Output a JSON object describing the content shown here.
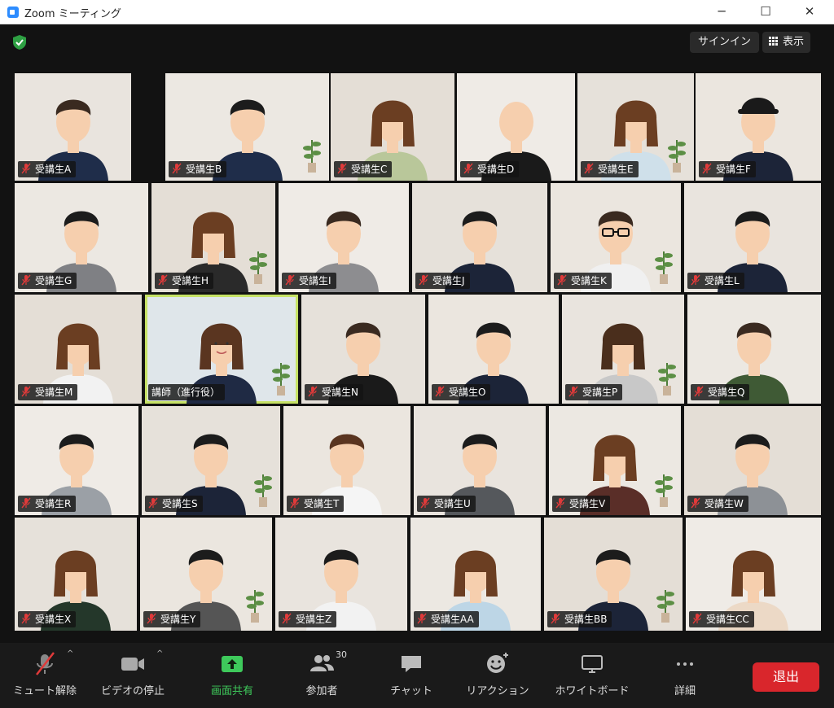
{
  "window": {
    "title": "Zoom ミーティング",
    "minimize": "─",
    "maximize": "☐",
    "close": "✕"
  },
  "header": {
    "signin_label": "サインイン",
    "view_label": "表示",
    "security_icon": "shield-check-icon"
  },
  "colors": {
    "host_border": "#c6e265",
    "share_green": "#3ec95b",
    "leave_red": "#d9262c",
    "mute_red": "#e03a3a"
  },
  "participants": [
    {
      "name": "受講生A",
      "muted": true,
      "hair": "#3a2a20",
      "shirt": "#1f2d4a",
      "gender": "m"
    },
    {
      "name": "受講生B",
      "muted": true,
      "hair": "#1c1c1c",
      "shirt": "#1f2d4a",
      "gender": "m"
    },
    {
      "name": "受講生C",
      "muted": true,
      "hair": "#6b3e22",
      "shirt": "#b9c79a",
      "gender": "f"
    },
    {
      "name": "受講生D",
      "muted": true,
      "hair": "#f3c9a8",
      "shirt": "#1a1a1a",
      "gender": "b"
    },
    {
      "name": "受講生E",
      "muted": true,
      "hair": "#6b3e22",
      "shirt": "#cfe0ea",
      "gender": "f"
    },
    {
      "name": "受講生F",
      "muted": true,
      "hair": "#1a1a1a",
      "shirt": "#1c2438",
      "gender": "c"
    },
    {
      "name": "受講生G",
      "muted": true,
      "hair": "#1c1c1c",
      "shirt": "#7f8084",
      "gender": "m"
    },
    {
      "name": "受講生H",
      "muted": true,
      "hair": "#6b3e22",
      "shirt": "#2a2a2a",
      "gender": "f"
    },
    {
      "name": "受講生I",
      "muted": true,
      "hair": "#3a2a20",
      "shirt": "#8d8d90",
      "gender": "m"
    },
    {
      "name": "受講生J",
      "muted": true,
      "hair": "#1c1c1c",
      "shirt": "#1c2438",
      "gender": "m"
    },
    {
      "name": "受講生K",
      "muted": true,
      "hair": "#3a2a20",
      "shirt": "#f0f0f0",
      "gender": "g"
    },
    {
      "name": "受講生L",
      "muted": true,
      "hair": "#1c1c1c",
      "shirt": "#1c2438",
      "gender": "m"
    },
    {
      "name": "受講生M",
      "muted": true,
      "hair": "#6b3e22",
      "shirt": "#f2f2f2",
      "gender": "f"
    },
    {
      "name": "講師（進行役）",
      "muted": false,
      "hair": "#5a3520",
      "shirt": "#1f2a44",
      "gender": "f"
    },
    {
      "name": "受講生N",
      "muted": true,
      "hair": "#3a2a20",
      "shirt": "#1a1a1a",
      "gender": "m"
    },
    {
      "name": "受講生O",
      "muted": true,
      "hair": "#1c1c1c",
      "shirt": "#1c2438",
      "gender": "m"
    },
    {
      "name": "受講生P",
      "muted": true,
      "hair": "#4a2e1c",
      "shirt": "#c8c8c8",
      "gender": "f"
    },
    {
      "name": "受講生Q",
      "muted": true,
      "hair": "#3a2a20",
      "shirt": "#3f5a35",
      "gender": "m"
    },
    {
      "name": "受講生R",
      "muted": true,
      "hair": "#1c1c1c",
      "shirt": "#9ba0a6",
      "gender": "m"
    },
    {
      "name": "受講生S",
      "muted": true,
      "hair": "#1c1c1c",
      "shirt": "#1c2438",
      "gender": "m"
    },
    {
      "name": "受講生T",
      "muted": true,
      "hair": "#5a3520",
      "shirt": "#f5f5f5",
      "gender": "m"
    },
    {
      "name": "受講生U",
      "muted": true,
      "hair": "#1c1c1c",
      "shirt": "#55585c",
      "gender": "m"
    },
    {
      "name": "受講生V",
      "muted": true,
      "hair": "#6b3e22",
      "shirt": "#5a2e28",
      "gender": "f"
    },
    {
      "name": "受講生W",
      "muted": true,
      "hair": "#1c1c1c",
      "shirt": "#8d9196",
      "gender": "m"
    },
    {
      "name": "受講生X",
      "muted": true,
      "hair": "#6b3e22",
      "shirt": "#24372a",
      "gender": "f"
    },
    {
      "name": "受講生Y",
      "muted": true,
      "hair": "#1c1c1c",
      "shirt": "#555",
      "gender": "m"
    },
    {
      "name": "受講生Z",
      "muted": true,
      "hair": "#1c1c1c",
      "shirt": "#f2f2f2",
      "gender": "m"
    },
    {
      "name": "受講生AA",
      "muted": true,
      "hair": "#6b3e22",
      "shirt": "#bdd6e6",
      "gender": "f"
    },
    {
      "name": "受講生BB",
      "muted": true,
      "hair": "#1c1c1c",
      "shirt": "#1c2438",
      "gender": "m"
    },
    {
      "name": "受講生CC",
      "muted": true,
      "hair": "#6b3e22",
      "shirt": "#ecd9c6",
      "gender": "f"
    }
  ],
  "toolbar": {
    "mute_label": "ミュート解除",
    "video_label": "ビデオの停止",
    "share_label": "画面共有",
    "participants_label": "参加者",
    "participants_count": "30",
    "chat_label": "チャット",
    "reaction_label": "リアクション",
    "whiteboard_label": "ホワイトボード",
    "more_label": "詳細",
    "leave_label": "退出"
  }
}
